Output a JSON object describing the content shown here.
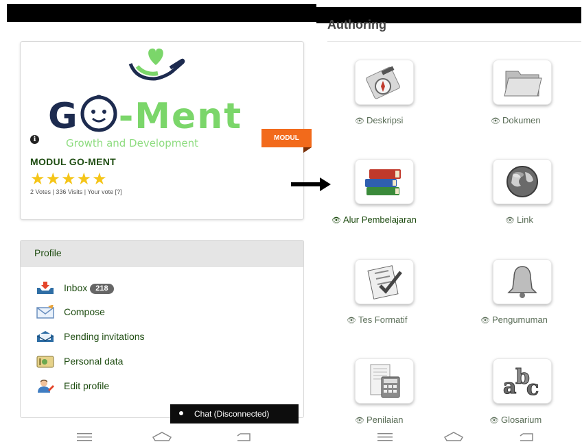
{
  "left": {
    "module_card": {
      "logo_text_g": "G",
      "logo_text_ment": "-Ment",
      "logo_subtitle": "Growth and Development",
      "ribbon": "MODUL",
      "title": "MODUL GO-MENT",
      "rating_stars": 5,
      "stars": "★★★★★",
      "votes_line": "2 Votes | 336 Visits | Your vote [?]"
    },
    "profile": {
      "header": "Profile",
      "items": [
        {
          "label": "Inbox",
          "badge": "218",
          "icon": "inbox-icon"
        },
        {
          "label": "Compose",
          "icon": "envelope-icon"
        },
        {
          "label": "Pending invitations",
          "icon": "invitation-icon"
        },
        {
          "label": "Personal data",
          "icon": "id-card-icon"
        },
        {
          "label": "Edit profile",
          "icon": "user-edit-icon"
        }
      ]
    },
    "chat": "Chat (Disconnected)"
  },
  "right": {
    "title": "Authoring",
    "tiles": [
      {
        "label": "Deskripsi",
        "icon": "compass-icon",
        "visible": false
      },
      {
        "label": "Dokumen",
        "icon": "folder-icon",
        "visible": false
      },
      {
        "label": "Alur Pembelajaran",
        "icon": "books-icon",
        "visible": true
      },
      {
        "label": "Link",
        "icon": "globe-icon",
        "visible": false
      },
      {
        "label": "Tes Formatif",
        "icon": "checklist-icon",
        "visible": false
      },
      {
        "label": "Pengumuman",
        "icon": "bell-icon",
        "visible": false
      },
      {
        "label": "Penilaian",
        "icon": "calculator-icon",
        "visible": false
      },
      {
        "label": "Glosarium",
        "icon": "abc-icon",
        "visible": false
      }
    ]
  },
  "nav_icons": [
    "menu-icon",
    "home-icon",
    "back-icon"
  ],
  "colors": {
    "accent_green": "#1f4d12",
    "ribbon_orange": "#f26a1b",
    "star_yellow": "#f5c518"
  }
}
